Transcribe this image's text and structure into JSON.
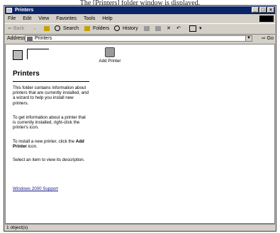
{
  "caption": "The [Printers] folder window is displayed.",
  "window": {
    "title": "Printers",
    "controls": [
      "_",
      "□",
      "×"
    ]
  },
  "menu": [
    "File",
    "Edit",
    "View",
    "Favorites",
    "Tools",
    "Help"
  ],
  "toolbar": {
    "back": "Back",
    "forward": "→",
    "search": "Search",
    "folders": "Folders",
    "history": "History",
    "views": "Views"
  },
  "address": {
    "label": "Address",
    "value": "Printers",
    "go": "Go"
  },
  "left_pane": {
    "heading": "Printers",
    "p1": "This folder contains information about printers that are currently installed, and a wizard to help you install new printers.",
    "p2": "To get information about a printer that is currently installed, right-click the printer's icon.",
    "p3_prefix": "To install a new printer, click the",
    "p3_bold": "Add Printer",
    "p3_suffix": "icon.",
    "p4": "Select an item to view its description.",
    "support_link": "Windows 2000 Support"
  },
  "items": [
    {
      "label": "Add Printer",
      "icon": "printer-icon"
    }
  ],
  "status": {
    "text": "1 object(s)"
  }
}
